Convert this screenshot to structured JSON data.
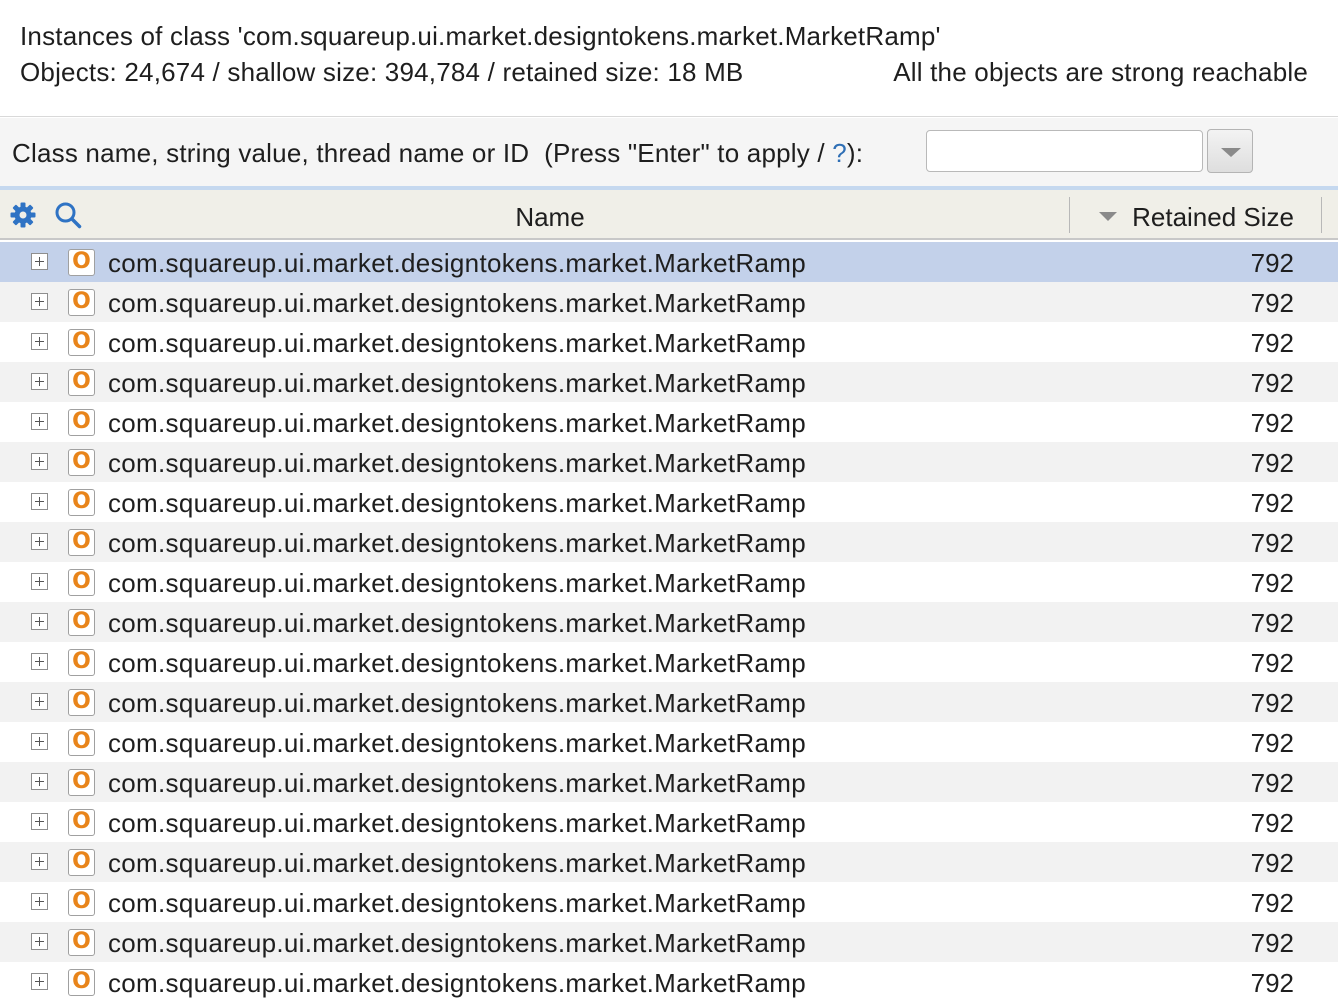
{
  "summary": {
    "title": "Instances of class 'com.squareup.ui.market.designtokens.market.MarketRamp'",
    "stats": "Objects: 24,674 / shallow size: 394,784 / retained size: 18 MB",
    "reachability": "All the objects are strong reachable"
  },
  "filter": {
    "label_prefix": "Class name, string value, thread name or ID  (Press \"Enter\" to apply / ",
    "help_link": "?",
    "label_suffix": "):",
    "value": ""
  },
  "table": {
    "columns": {
      "name": "Name",
      "retained_size": "Retained Size"
    },
    "sort": {
      "column": "retained_size",
      "direction": "descending"
    },
    "rows": [
      {
        "icon": "O",
        "name": "com.squareup.ui.market.designtokens.market.MarketRamp",
        "size": "792",
        "selected": true
      },
      {
        "icon": "O",
        "name": "com.squareup.ui.market.designtokens.market.MarketRamp",
        "size": "792"
      },
      {
        "icon": "O",
        "name": "com.squareup.ui.market.designtokens.market.MarketRamp",
        "size": "792"
      },
      {
        "icon": "O",
        "name": "com.squareup.ui.market.designtokens.market.MarketRamp",
        "size": "792"
      },
      {
        "icon": "O",
        "name": "com.squareup.ui.market.designtokens.market.MarketRamp",
        "size": "792"
      },
      {
        "icon": "O",
        "name": "com.squareup.ui.market.designtokens.market.MarketRamp",
        "size": "792"
      },
      {
        "icon": "O",
        "name": "com.squareup.ui.market.designtokens.market.MarketRamp",
        "size": "792"
      },
      {
        "icon": "O",
        "name": "com.squareup.ui.market.designtokens.market.MarketRamp",
        "size": "792"
      },
      {
        "icon": "O",
        "name": "com.squareup.ui.market.designtokens.market.MarketRamp",
        "size": "792"
      },
      {
        "icon": "O",
        "name": "com.squareup.ui.market.designtokens.market.MarketRamp",
        "size": "792"
      },
      {
        "icon": "O",
        "name": "com.squareup.ui.market.designtokens.market.MarketRamp",
        "size": "792"
      },
      {
        "icon": "O",
        "name": "com.squareup.ui.market.designtokens.market.MarketRamp",
        "size": "792"
      },
      {
        "icon": "O",
        "name": "com.squareup.ui.market.designtokens.market.MarketRamp",
        "size": "792"
      },
      {
        "icon": "O",
        "name": "com.squareup.ui.market.designtokens.market.MarketRamp",
        "size": "792"
      },
      {
        "icon": "O",
        "name": "com.squareup.ui.market.designtokens.market.MarketRamp",
        "size": "792"
      },
      {
        "icon": "O",
        "name": "com.squareup.ui.market.designtokens.market.MarketRamp",
        "size": "792"
      },
      {
        "icon": "O",
        "name": "com.squareup.ui.market.designtokens.market.MarketRamp",
        "size": "792"
      },
      {
        "icon": "O",
        "name": "com.squareup.ui.market.designtokens.market.MarketRamp",
        "size": "792"
      },
      {
        "icon": "O",
        "name": "com.squareup.ui.market.designtokens.market.MarketRamp",
        "size": "792"
      }
    ]
  },
  "icons": {
    "settings": "gear-icon",
    "search": "search-icon",
    "expand": "expand-plus-icon",
    "object": "object-instance-icon",
    "sort": "sort-descending-icon",
    "filter_dropdown": "chevron-down-icon"
  },
  "colors": {
    "selection": "#c3d1ea",
    "row_alt": "#f2f2f2",
    "header_bg": "#f0efe8",
    "toolbar_icon": "#2f73c4",
    "object_icon": "#e8841a",
    "help_link": "#2f6fb5"
  }
}
